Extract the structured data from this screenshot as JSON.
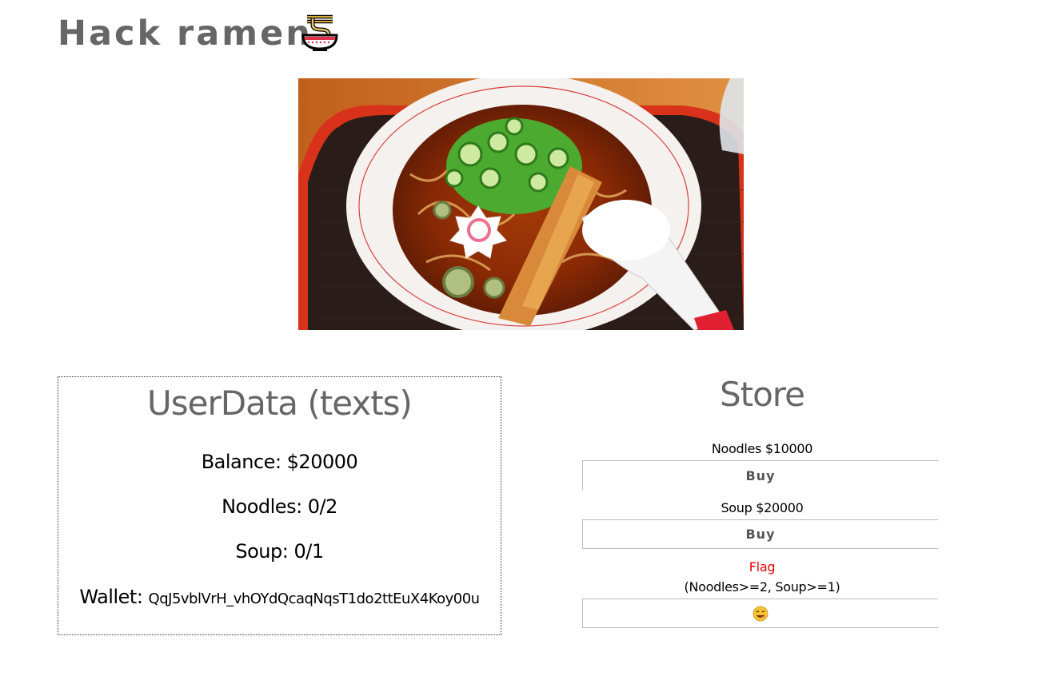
{
  "header": {
    "title": "Hack ramen",
    "icon": "ramen-bowl-icon"
  },
  "hero": {
    "image": "ramen-bowl-photo"
  },
  "userdata": {
    "heading": "UserData (texts)",
    "balance": "Balance: $20000",
    "noodles": "Noodles: 0/2",
    "soup": "Soup: 0/1",
    "wallet_label": "Wallet:",
    "wallet_value": "QqJ5vblVrH_vhOYdQcaqNqsT1do2ttEuX4Koy00u"
  },
  "store": {
    "heading": "Store",
    "noodles_label": "Noodles $10000",
    "noodles_button": "Buy",
    "soup_label": "Soup $20000",
    "soup_button": "Buy",
    "flag_label": "Flag",
    "flag_condition": "(Noodles>=2, Soup>=1)",
    "flag_button_icon": "smiling-face-savoring-food-icon"
  },
  "colors": {
    "title": "#666666",
    "flag": "#e00000",
    "border": "#bbbbbb"
  }
}
